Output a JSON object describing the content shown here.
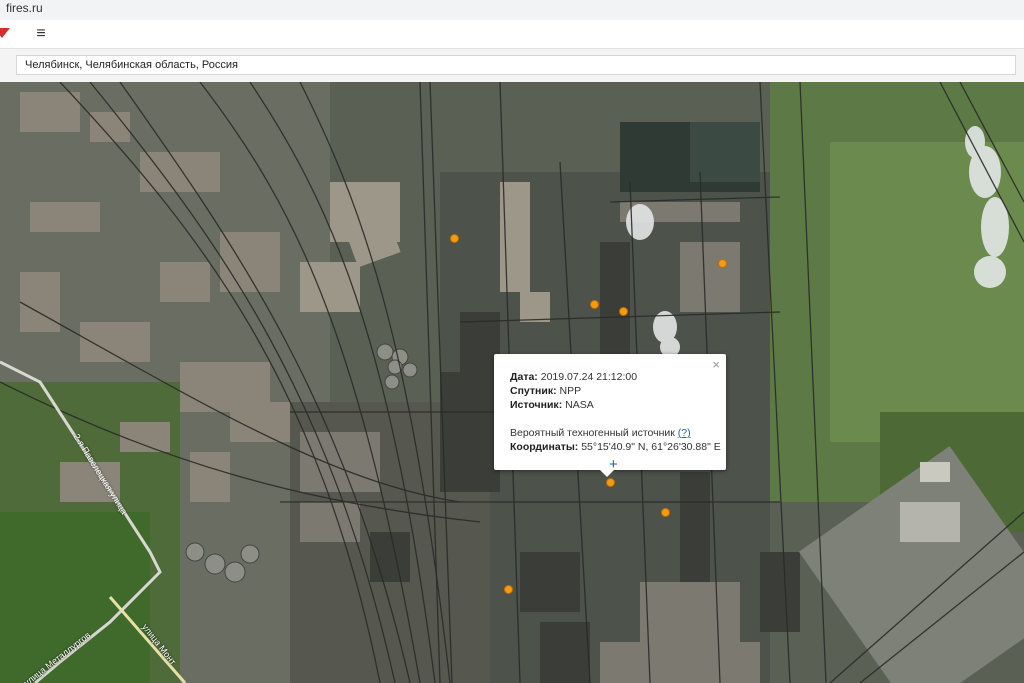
{
  "browser": {
    "url": "fires.ru"
  },
  "toolbar": {
    "menu_icon": "hamburger-icon",
    "menu_glyph": "≡",
    "logo_icon": "fire-logo-icon"
  },
  "search": {
    "value": "Челябинск, Челябинская область, Россия"
  },
  "popup": {
    "date_label": "Дата:",
    "date_value": "2019.07.24 21:12:00",
    "satellite_label": "Спутник:",
    "satellite_value": "NPP",
    "source_label": "Источник:",
    "source_value": "NASA",
    "probable_source": "Вероятный техногенный источник",
    "help_link": "(?)",
    "coords_label": "Координаты:",
    "coords_value": "55°15'40.9\" N, 61°26'30.88\" E",
    "close_glyph": "×"
  },
  "map": {
    "center_marker_glyph": "+",
    "road_labels": [
      "2-я Павелецкая улица",
      "улица Металлургов",
      "улица Монт"
    ],
    "fire_marker_color": "#f39c12"
  }
}
